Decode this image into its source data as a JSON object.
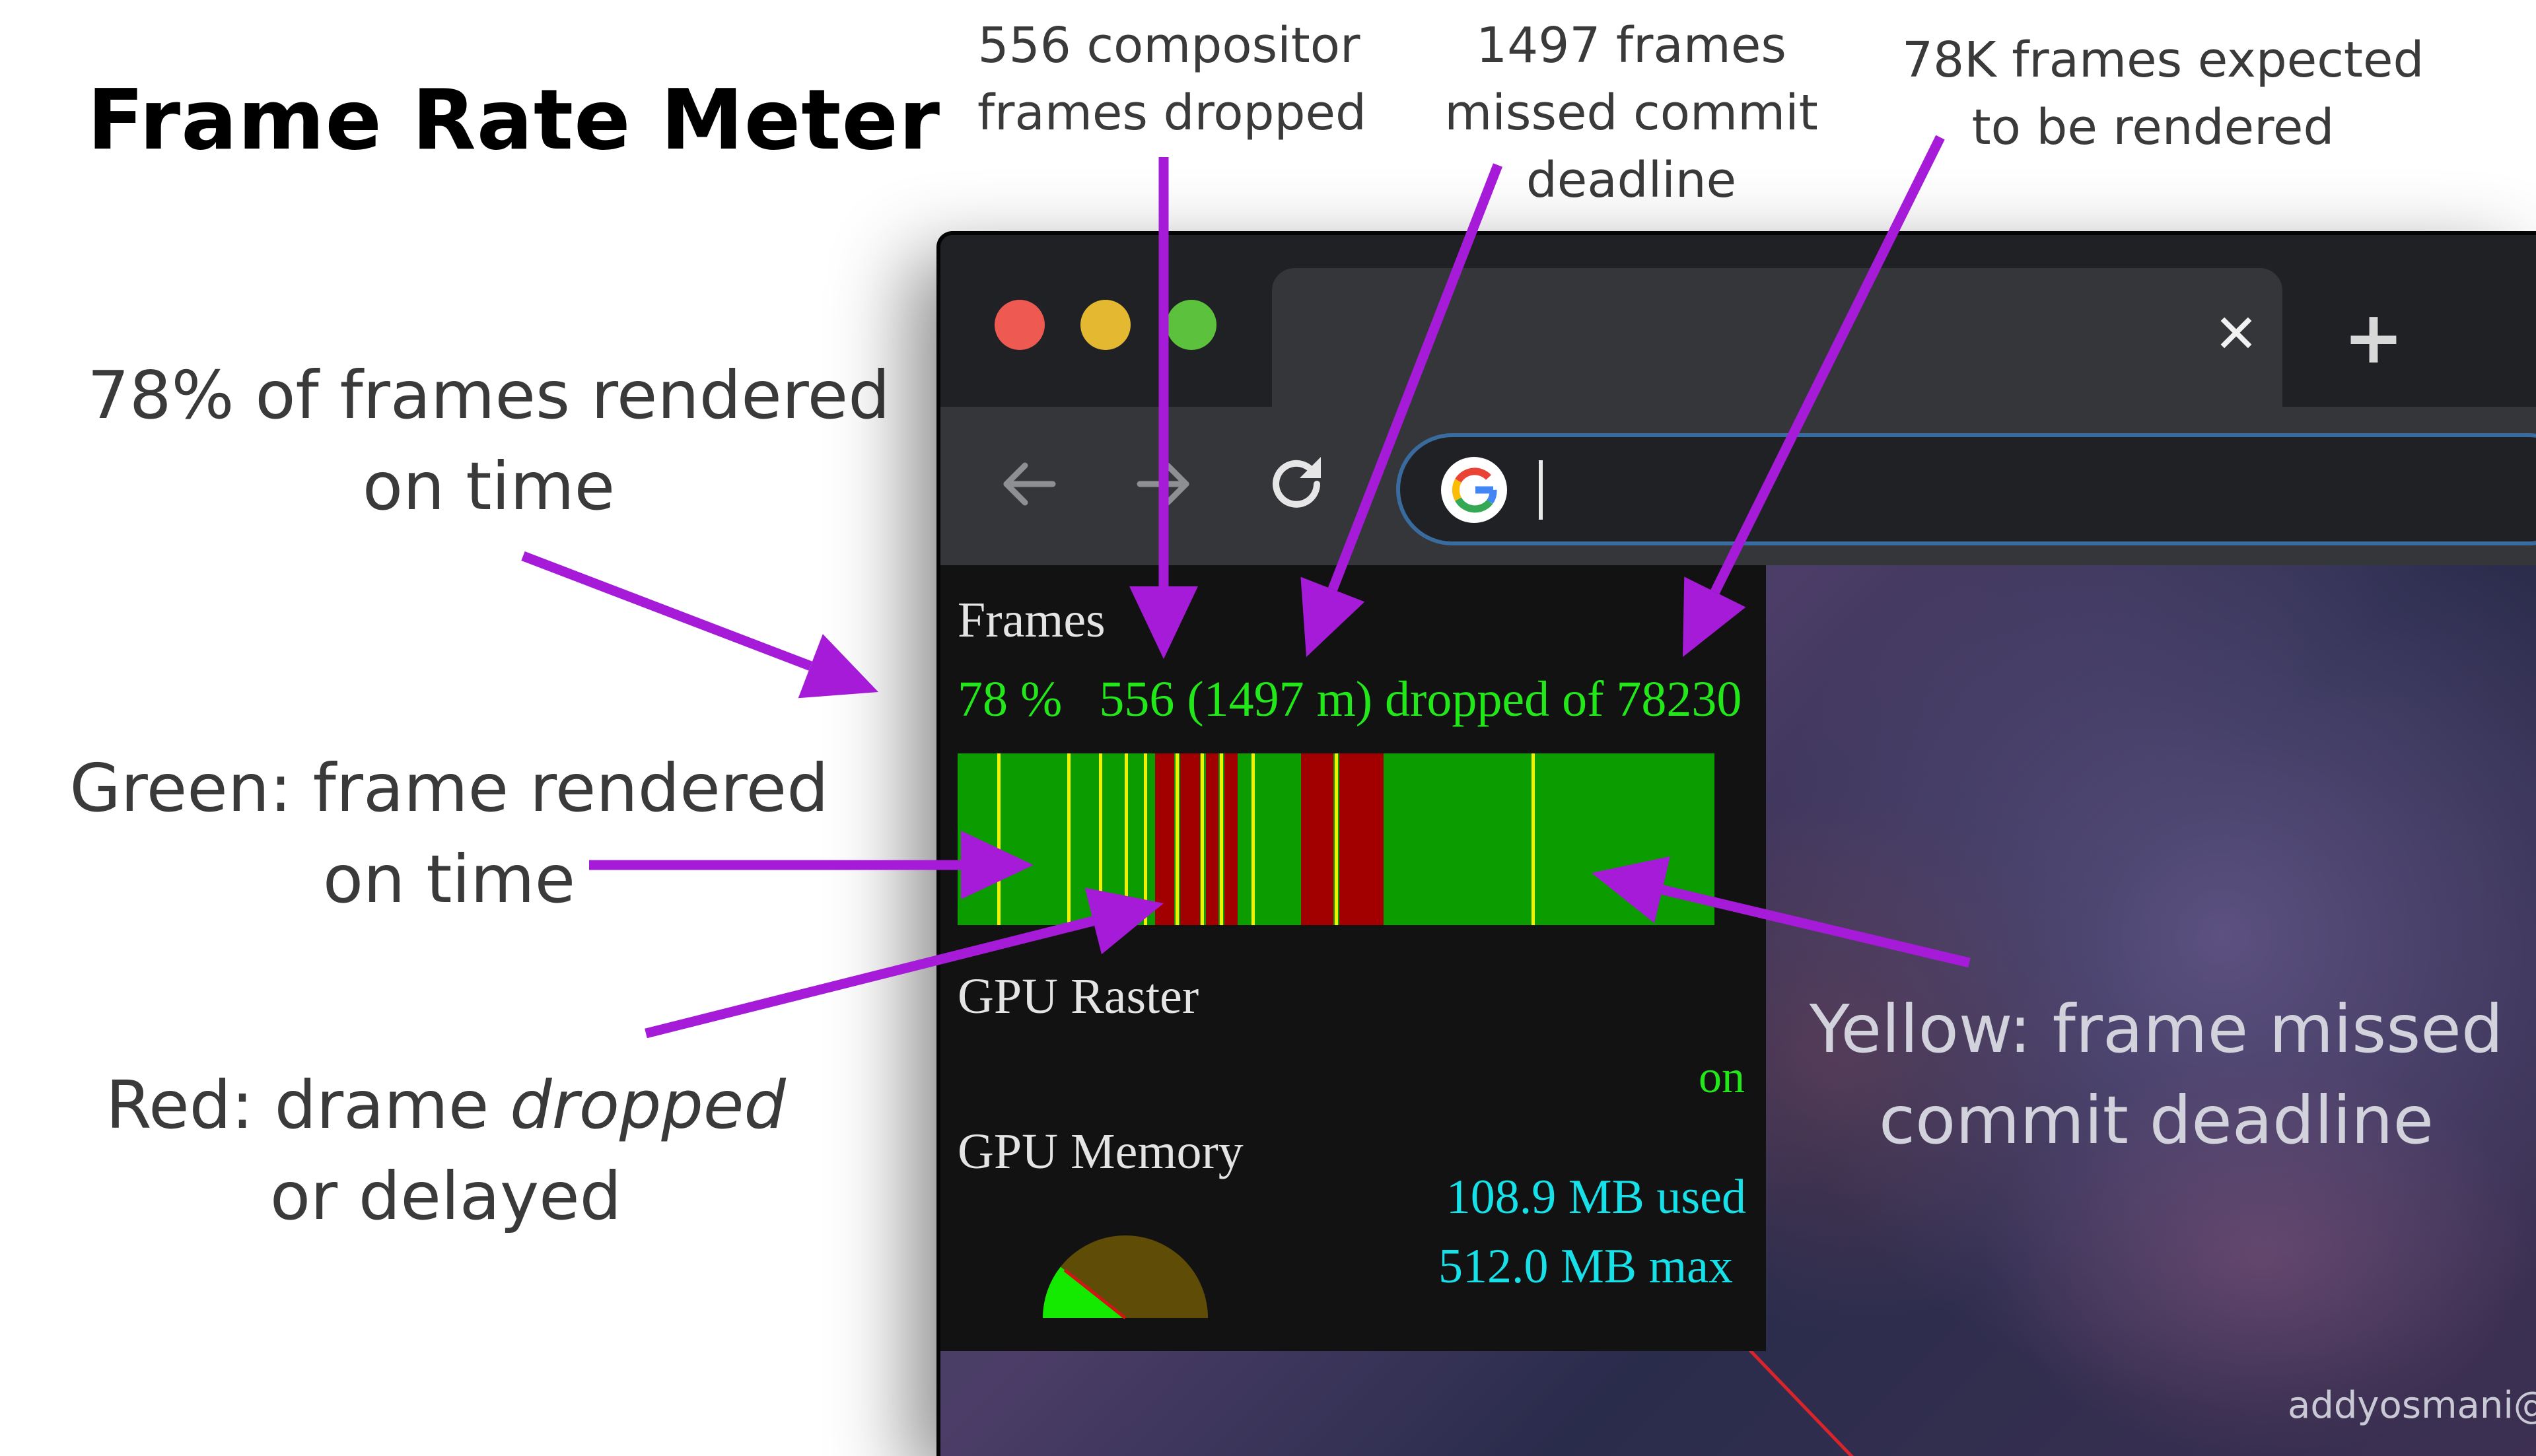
{
  "slide": {
    "title": "Frame Rate Meter",
    "annotations": {
      "compositor_dropped": [
        "556 compositor",
        "frames dropped"
      ],
      "missed_commit": [
        "1497 frames",
        "missed commit",
        "deadline"
      ],
      "expected": [
        "78K frames expected",
        "to be rendered"
      ],
      "on_time_pct": [
        "78% of frames rendered",
        "on time"
      ],
      "green": [
        "Green: frame rendered",
        "on time"
      ],
      "red_before": "Red: drame ",
      "red_italic": "dropped",
      "red_line2": "or delayed",
      "yellow": [
        "Yellow: frame missed",
        "commit deadline"
      ]
    },
    "arrow_color": "#a51bd8",
    "watermark": "addyosmani@"
  },
  "browser": {
    "tab_close_glyph": "✕",
    "new_tab_glyph": "+",
    "nav_icons": [
      "back-arrow-icon",
      "forward-arrow-icon",
      "reload-icon"
    ],
    "omnibox_value": ""
  },
  "hud": {
    "frames_label": "Frames",
    "on_time_percent": "78 %",
    "dropped_summary": "556 (1497 m) dropped of 78230",
    "frames_on_time_fraction": 0.78,
    "compositor_dropped": 556,
    "missed_commit": 1497,
    "expected": 78230,
    "gpu_raster_label": "GPU Raster",
    "gpu_raster_state": "on",
    "gpu_memory_label": "GPU Memory",
    "memory_used": "108.9 MB used",
    "memory_max": "512.0 MB max",
    "memory_used_fraction": 0.213,
    "colors": {
      "on_time": "#0b9c00",
      "dropped": "#a20000",
      "missed_commit": "#f0f000",
      "stats_text": "#22e81a",
      "memory_text": "#16e0e8"
    },
    "frame_timeline": [
      "g",
      "g",
      "g",
      "g",
      "g",
      "g",
      "y",
      "g",
      "g",
      "g",
      "g",
      "g",
      "g",
      "g",
      "g",
      "g",
      "g",
      "y",
      "g",
      "g",
      "g",
      "g",
      "y",
      "g",
      "g",
      "g",
      "y",
      "g",
      "g",
      "y",
      "g",
      "r",
      "r",
      "r",
      "y",
      "r",
      "r",
      "r",
      "y",
      "r",
      "r",
      "y",
      "r",
      "r",
      "g",
      "g",
      "y",
      "g",
      "g",
      "g",
      "g",
      "g",
      "g",
      "g",
      "r",
      "r",
      "r",
      "r",
      "r",
      "y",
      "r",
      "r",
      "r",
      "r",
      "r",
      "r",
      "r",
      "g",
      "g",
      "g",
      "g",
      "g",
      "g",
      "g",
      "g",
      "g",
      "g",
      "g",
      "g",
      "g",
      "g",
      "g",
      "g",
      "g",
      "g",
      "g",
      "g",
      "g",
      "g",
      "g",
      "y",
      "g",
      "g",
      "g",
      "g",
      "g",
      "g",
      "g",
      "g",
      "g",
      "g",
      "g",
      "g",
      "g",
      "g",
      "g",
      "g",
      "g",
      "g",
      "g",
      "g",
      "g",
      "g",
      "g",
      "g",
      "g",
      "g",
      "g",
      "g"
    ]
  }
}
